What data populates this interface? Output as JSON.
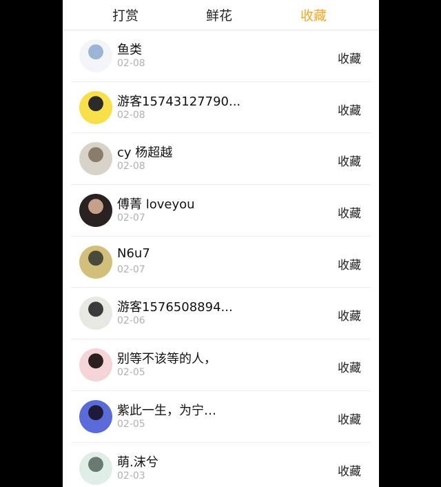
{
  "tabs": [
    {
      "label": "打赏",
      "active": false
    },
    {
      "label": "鲜花",
      "active": false
    },
    {
      "label": "收藏",
      "active": true
    }
  ],
  "accent_color": "#f5a623",
  "items": [
    {
      "name": "鱼类",
      "date": "02-08",
      "action": "收藏",
      "avatar_colors": [
        "#f3f5f8",
        "#9db4d6"
      ]
    },
    {
      "name": "游客15743127790...",
      "date": "02-08",
      "action": "收藏",
      "avatar_colors": [
        "#f7e04a",
        "#2b2b2b"
      ]
    },
    {
      "name": "cy 杨超越",
      "date": "02-08",
      "action": "收藏",
      "avatar_colors": [
        "#d8d3c8",
        "#8b7d6b"
      ]
    },
    {
      "name": "傅菁 loveyou",
      "date": "02-07",
      "action": "收藏",
      "avatar_colors": [
        "#2a2220",
        "#c7a08a"
      ]
    },
    {
      "name": "N6u7",
      "date": "02-07",
      "action": "收藏",
      "avatar_colors": [
        "#d2c07a",
        "#4a4a3a"
      ]
    },
    {
      "name": "游客1576508894...",
      "date": "02-06",
      "action": "收藏",
      "avatar_colors": [
        "#e8e8e2",
        "#3b3b3b"
      ]
    },
    {
      "name": "别等不该等的人，",
      "date": "02-05",
      "action": "收藏",
      "avatar_colors": [
        "#f4d4d6",
        "#2b1f1f"
      ]
    },
    {
      "name": "紫此一生，为宁…",
      "date": "02-05",
      "action": "收藏",
      "avatar_colors": [
        "#5a6bd8",
        "#201a3a"
      ]
    },
    {
      "name": "萌.沫兮",
      "date": "02-03",
      "action": "收藏",
      "avatar_colors": [
        "#dfeee6",
        "#6b7a70"
      ]
    }
  ]
}
